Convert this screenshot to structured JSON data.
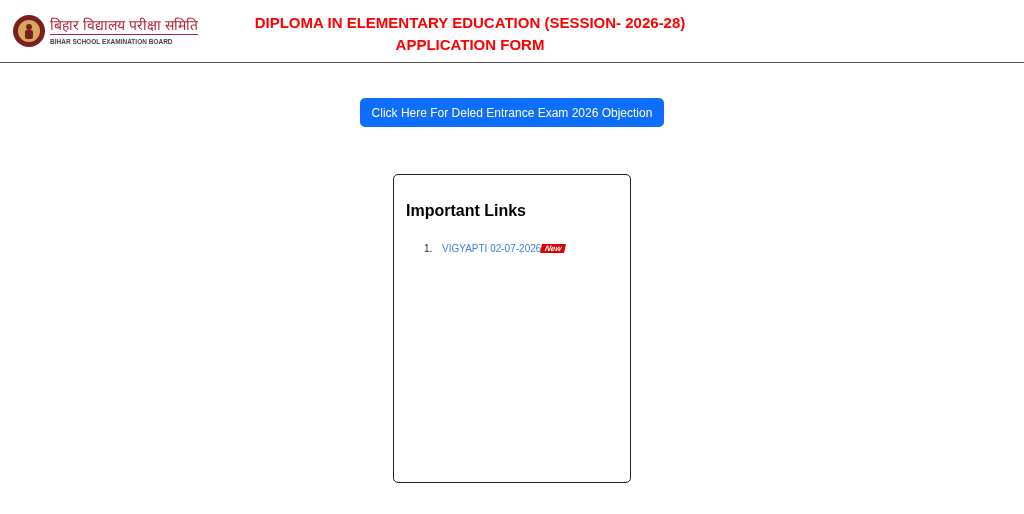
{
  "header": {
    "logo_hindi": "बिहार विद्यालय परीक्षा समिति",
    "logo_english": "BIHAR SCHOOL EXAMINATION BOARD",
    "title_lines": [
      "DIPLOMA IN ELEMENTARY EDUCATION (SESSION- 2026-28)",
      "APPLICATION FORM"
    ]
  },
  "objection_button": "Click Here For Deled Entrance Exam 2026 Objection",
  "important_links": {
    "title": "Important Links",
    "items": [
      {
        "number": "1.",
        "label": "VIGYAPTI 02-07-2026",
        "badge": "New"
      }
    ]
  }
}
